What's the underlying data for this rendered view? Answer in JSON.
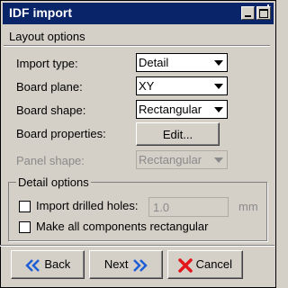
{
  "window": {
    "title": "IDF import"
  },
  "section": {
    "label": "Layout options"
  },
  "form": {
    "import_type": {
      "label": "Import type:",
      "value": "Detail"
    },
    "board_plane": {
      "label": "Board plane:",
      "value": "XY"
    },
    "board_shape": {
      "label": "Board shape:",
      "value": "Rectangular"
    },
    "board_properties": {
      "label": "Board properties:",
      "button": "Edit..."
    },
    "panel_shape": {
      "label": "Panel shape:",
      "value": "Rectangular",
      "disabled": true
    }
  },
  "detail_options": {
    "title": "Detail options",
    "import_drilled_holes": {
      "label": "Import drilled holes:",
      "checked": false,
      "value": "1.0",
      "unit": "mm"
    },
    "make_rectangular": {
      "label": "Make all components rectangular",
      "checked": false
    }
  },
  "footer": {
    "back": "Back",
    "next": "Next",
    "cancel": "Cancel"
  },
  "colors": {
    "title_bar": "#0a246a",
    "arrow_icon": "#1f5fd6",
    "cancel_icon": "#e3161b",
    "face": "#d4d0c8"
  },
  "icons": {
    "back": "double-chevron-left-icon",
    "next": "double-chevron-right-icon",
    "cancel": "red-x-icon"
  }
}
